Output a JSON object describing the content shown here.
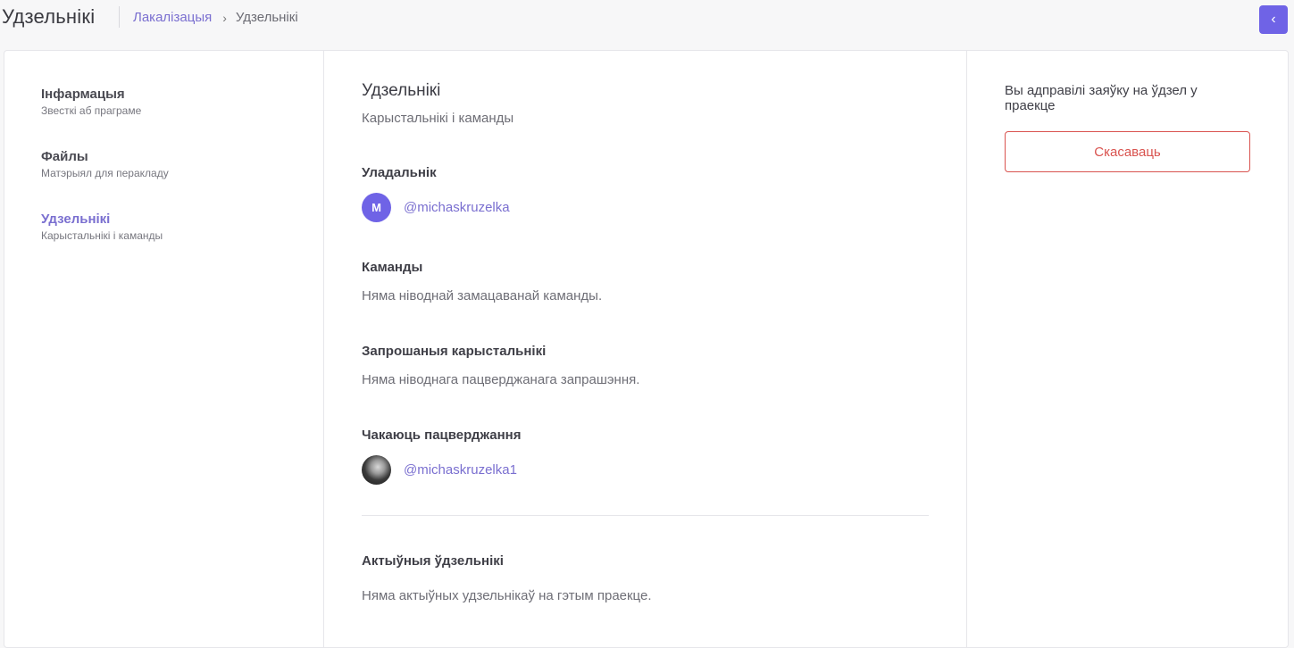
{
  "header": {
    "title": "Удзельнікі",
    "breadcrumb": {
      "link": "Лакалізацыя",
      "separator": "›",
      "current": "Удзельнікі"
    },
    "back_icon": "‹"
  },
  "sidebar": {
    "items": [
      {
        "title": "Інфармацыя",
        "subtitle": "Звесткі аб праграме"
      },
      {
        "title": "Файлы",
        "subtitle": "Матэрыял для перакладу"
      },
      {
        "title": "Удзельнікі",
        "subtitle": "Карыстальнікі і каманды",
        "active": true
      }
    ]
  },
  "main": {
    "title": "Удзельнікі",
    "subtitle": "Карыстальнікі і каманды",
    "owner": {
      "heading": "Уладальнік",
      "avatar_letter": "M",
      "username": "@michaskruzelka"
    },
    "teams": {
      "heading": "Каманды",
      "empty": "Няма ніводнай замацаванай каманды."
    },
    "invited": {
      "heading": "Запрошаныя карыстальнікі",
      "empty": "Няма ніводнага пацверджанага запрашэння."
    },
    "pending": {
      "heading": "Чакаюць пацверджання",
      "username": "@michaskruzelka1"
    },
    "active": {
      "heading": "Актыўныя ўдзельнікі",
      "empty": "Няма актыўных удзельнікаў на гэтым праекце."
    }
  },
  "right": {
    "request_text": "Вы адправілі заяўку на ўдзел у праекце",
    "cancel_label": "Скасаваць"
  },
  "colors": {
    "accent": "#6f63e6",
    "link": "#7a6fd0",
    "danger": "#d9534f"
  }
}
